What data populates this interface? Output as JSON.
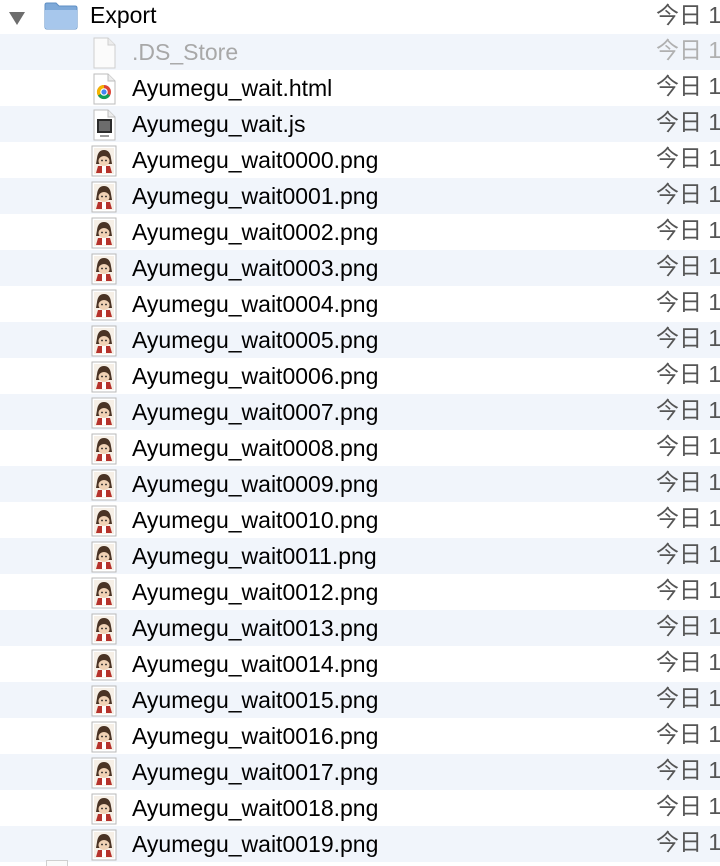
{
  "folder": {
    "name": "Export",
    "date": "今日 1",
    "icon": "folder-icon",
    "expanded": true
  },
  "files": [
    {
      "name": ".DS_Store",
      "date": "今日 1",
      "icon": "blank-document-icon",
      "dimmed": true
    },
    {
      "name": "Ayumegu_wait.html",
      "date": "今日 1",
      "icon": "chrome-html-document-icon"
    },
    {
      "name": "Ayumegu_wait.js",
      "date": "今日 1",
      "icon": "js-script-icon"
    },
    {
      "name": "Ayumegu_wait0000.png",
      "date": "今日 1",
      "icon": "png-thumbnail-icon"
    },
    {
      "name": "Ayumegu_wait0001.png",
      "date": "今日 1",
      "icon": "png-thumbnail-icon"
    },
    {
      "name": "Ayumegu_wait0002.png",
      "date": "今日 1",
      "icon": "png-thumbnail-icon"
    },
    {
      "name": "Ayumegu_wait0003.png",
      "date": "今日 1",
      "icon": "png-thumbnail-icon"
    },
    {
      "name": "Ayumegu_wait0004.png",
      "date": "今日 1",
      "icon": "png-thumbnail-icon"
    },
    {
      "name": "Ayumegu_wait0005.png",
      "date": "今日 1",
      "icon": "png-thumbnail-icon"
    },
    {
      "name": "Ayumegu_wait0006.png",
      "date": "今日 1",
      "icon": "png-thumbnail-icon"
    },
    {
      "name": "Ayumegu_wait0007.png",
      "date": "今日 1",
      "icon": "png-thumbnail-icon"
    },
    {
      "name": "Ayumegu_wait0008.png",
      "date": "今日 1",
      "icon": "png-thumbnail-icon"
    },
    {
      "name": "Ayumegu_wait0009.png",
      "date": "今日 1",
      "icon": "png-thumbnail-icon"
    },
    {
      "name": "Ayumegu_wait0010.png",
      "date": "今日 1",
      "icon": "png-thumbnail-icon"
    },
    {
      "name": "Ayumegu_wait0011.png",
      "date": "今日 1",
      "icon": "png-thumbnail-icon"
    },
    {
      "name": "Ayumegu_wait0012.png",
      "date": "今日 1",
      "icon": "png-thumbnail-icon"
    },
    {
      "name": "Ayumegu_wait0013.png",
      "date": "今日 1",
      "icon": "png-thumbnail-icon"
    },
    {
      "name": "Ayumegu_wait0014.png",
      "date": "今日 1",
      "icon": "png-thumbnail-icon"
    },
    {
      "name": "Ayumegu_wait0015.png",
      "date": "今日 1",
      "icon": "png-thumbnail-icon"
    },
    {
      "name": "Ayumegu_wait0016.png",
      "date": "今日 1",
      "icon": "png-thumbnail-icon"
    },
    {
      "name": "Ayumegu_wait0017.png",
      "date": "今日 1",
      "icon": "png-thumbnail-icon"
    },
    {
      "name": "Ayumegu_wait0018.png",
      "date": "今日 1",
      "icon": "png-thumbnail-icon"
    },
    {
      "name": "Ayumegu_wait0019.png",
      "date": "今日 1",
      "icon": "png-thumbnail-icon"
    }
  ],
  "colors": {
    "alt_row": "#f1f5fb",
    "folder_blue": "#8fb6e3",
    "dim_text": "#a8a8a8"
  }
}
